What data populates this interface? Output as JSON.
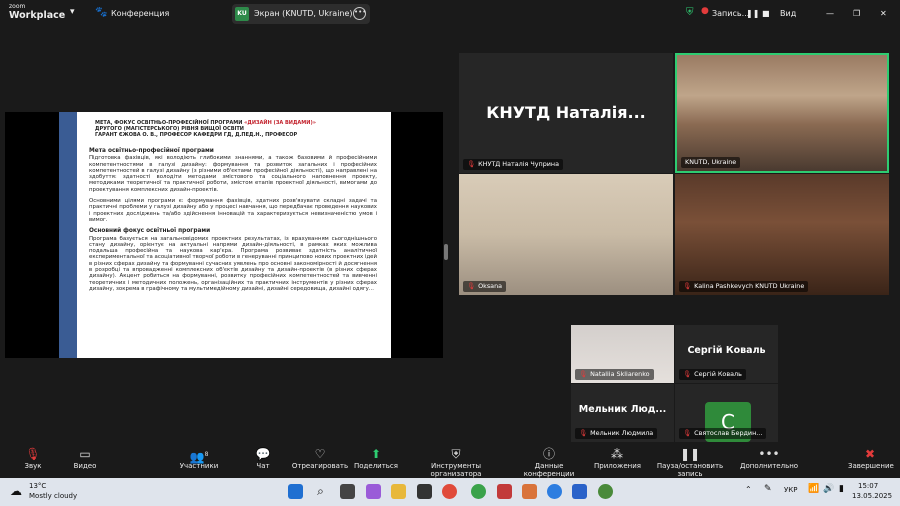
{
  "topbar": {
    "app_small": "zoom",
    "app_name": "Workplace",
    "conference": "Конференция",
    "screen_share": "Экран (KNUTD, Ukraine)",
    "screen_badge": "KU",
    "recording": "Запись...",
    "view": "Вид"
  },
  "slide": {
    "header_1a": "МЕТА, ФОКУС ОСВІТНЬО-ПРОФЕСІЙНОЇ ПРОГРАМИ ",
    "header_1b": "«ДИЗАЙН (ЗА ВИДАМИ)»",
    "header_2": "ДРУГОГО (МАГІСТЕРСЬКОГО) РІВНЯ ВИЩОЇ ОСВІТИ",
    "header_3": "ГАРАНТ ЄЖОВА О. В., ПРОФЕСОР КАФЕДРИ ГД, Д.ПЕД.Н., ПРОФЕСОР",
    "section1_title": "Мета освітньо-професійної програми",
    "section1_p1": "Підготовка фахівців, які володіють глибокими знаннями, а також базовими й професійними компетентностями в галузі дизайну: формування та розвиток загальних і професійних компетентностей в галузі дизайну (з різними об'єктами професійної діяльності), що направлені на здобуття: здатності володіти методами змістового та соціального наповнення проекту, методиками теоретичної та практичної роботи, змістом етапів проектної діяльності, вимогами до проектування комплексних дизайн-проектів.",
    "section1_p2": "Основними цілями програми є: формування фахівців, здатних розв'язувати складні задачі та практичні проблеми у галузі дизайну або у процесі навчання, що передбачає проведення наукових і проектних досліджень та/або здійснення інновацій та характеризується невизначеністю умов і вимог.",
    "section2_title": "Основний фокус освітньої програми",
    "section2_p1": "Програма базується на загальновідомих проектних результатах, із врахуванням сьогоднішнього стану дизайну, орієнтує на актуальні напрями дизайн-діяльності, в рамках яких можлива подальша професійна та наукова кар'єра. Програма розвиває здатність аналітичної експериментальної та асоціативної творчої роботи в генеруванні принципово нових проектних ідей в різних сферах дизайну та формуванні сучасних уявлень про основні закономірності й досягнення в розробці та впровадженні комплексних об'єктів дизайну та дизайн-проектів (в різних сферах дизайну). Акцент робиться на формуванні, розвитку професійних компетентностей та вивченні теоретичних і методичних положень, організаційних та практичних інструментів у різних сферах дизайну, зокрема в графічному та мультимедійному дизайні, дизайні середовища, дизайні одягу..."
  },
  "participants": {
    "p1_big": "КНУТД  Наталія...",
    "p1_label": "КНУТД Наталія Чуприна",
    "p2_label": "KNUTD, Ukraine",
    "p3_label": "Oksana",
    "p4_label": "Kalina Pashkevych KNUTD Ukraine",
    "p5_label": "Nataliia Skliarenko",
    "p6_big": "Сергій Коваль",
    "p6_label": "Сергій Коваль",
    "p7_big": "Мельник  Люд...",
    "p7_label": "Мельник Людмила",
    "p8_avatar": "С",
    "p8_label": "Святослав Бердин..."
  },
  "toolbar": {
    "sound": "Звук",
    "video": "Видео",
    "participants": "Участники",
    "participants_count": "8",
    "chat": "Чат",
    "react": "Отреагировать",
    "share": "Поделиться",
    "host_tools": "Инструменты организатора",
    "conference_data": "Данные конференции",
    "apps": "Приложения",
    "pause_record": "Пауза/остановить запись",
    "more": "Дополнительно",
    "end": "Завершение"
  },
  "taskbar": {
    "temp": "13°C",
    "weather": "Mostly cloudy",
    "lang": "УКР",
    "time": "15:07",
    "date": "13.05.2025"
  },
  "colors": {
    "accent_green": "#2ecc71",
    "slide_bar": "#3a5c94",
    "slide_red": "#c21f2a",
    "end_red": "#e23b3b"
  }
}
